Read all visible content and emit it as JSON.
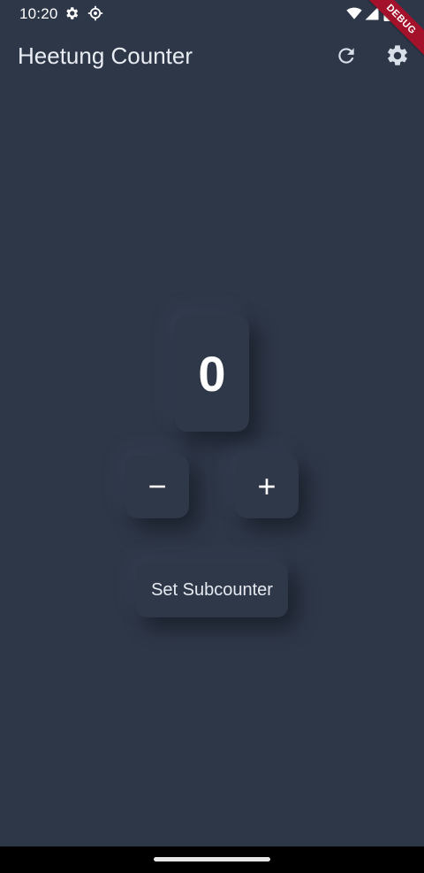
{
  "status_bar": {
    "time": "10:20",
    "left_icons": [
      "gear-icon",
      "settings-cog-icon"
    ],
    "right_icons": [
      "wifi-icon",
      "signal-icon",
      "battery-icon"
    ]
  },
  "debug_banner": {
    "label": "DEBUG",
    "color": "#a4112a"
  },
  "app_bar": {
    "title": "Heetung Counter",
    "actions": [
      "refresh-icon",
      "settings-icon"
    ]
  },
  "counter": {
    "value": "0"
  },
  "controls": {
    "decrement_label": "−",
    "increment_label": "+",
    "subcounter_label": "Set Subcounter"
  },
  "theme": {
    "background": "#2e3748",
    "text": "#ffffff"
  }
}
